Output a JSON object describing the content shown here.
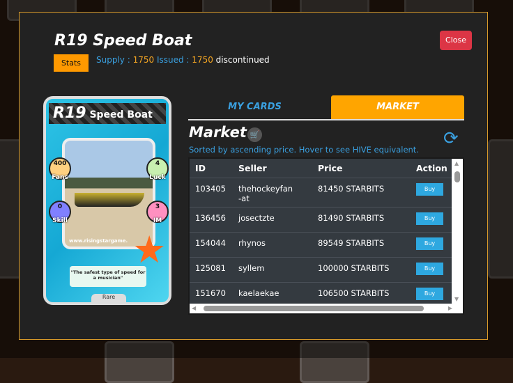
{
  "modal": {
    "title": "R19 Speed Boat",
    "stats_label": "Stats",
    "supply_label": "Supply :",
    "supply": "1750",
    "issued_label": "Issued :",
    "issued": "1750",
    "status": "discontinued",
    "close_label": "Close"
  },
  "card": {
    "number": "R19",
    "name": "Speed Boat",
    "fans": "400",
    "fans_label": "Fans",
    "luck": "4",
    "luck_label": "Luck",
    "skill": "0",
    "skill_label": "Skill",
    "im": "3",
    "im_label": "IM",
    "website": "www.risingstargame.",
    "quote": "\"The safest type of speed for a musician\"",
    "rarity": "Rare"
  },
  "tabs": [
    {
      "label": "MY CARDS"
    },
    {
      "label": "MARKET"
    }
  ],
  "market": {
    "heading": "Market",
    "note": "Sorted by ascending price. Hover to see HIVE equivalent.",
    "columns": [
      "ID",
      "Seller",
      "Price",
      "Action"
    ],
    "rows": [
      {
        "id": "103405",
        "seller": "thehockeyfan-at",
        "price": "81450 STARBITS",
        "action": "Buy"
      },
      {
        "id": "136456",
        "seller": "josectzte",
        "price": "81490 STARBITS",
        "action": "Buy"
      },
      {
        "id": "154044",
        "seller": "rhynos",
        "price": "89549 STARBITS",
        "action": "Buy"
      },
      {
        "id": "125081",
        "seller": "syllem",
        "price": "100000 STARBITS",
        "action": "Buy"
      },
      {
        "id": "151670",
        "seller": "kaelaekae",
        "price": "106500 STARBITS",
        "action": "Buy"
      }
    ]
  },
  "colors": {
    "accent": "#ffa500",
    "blue": "#3aa0e0",
    "close": "#dc3545"
  }
}
